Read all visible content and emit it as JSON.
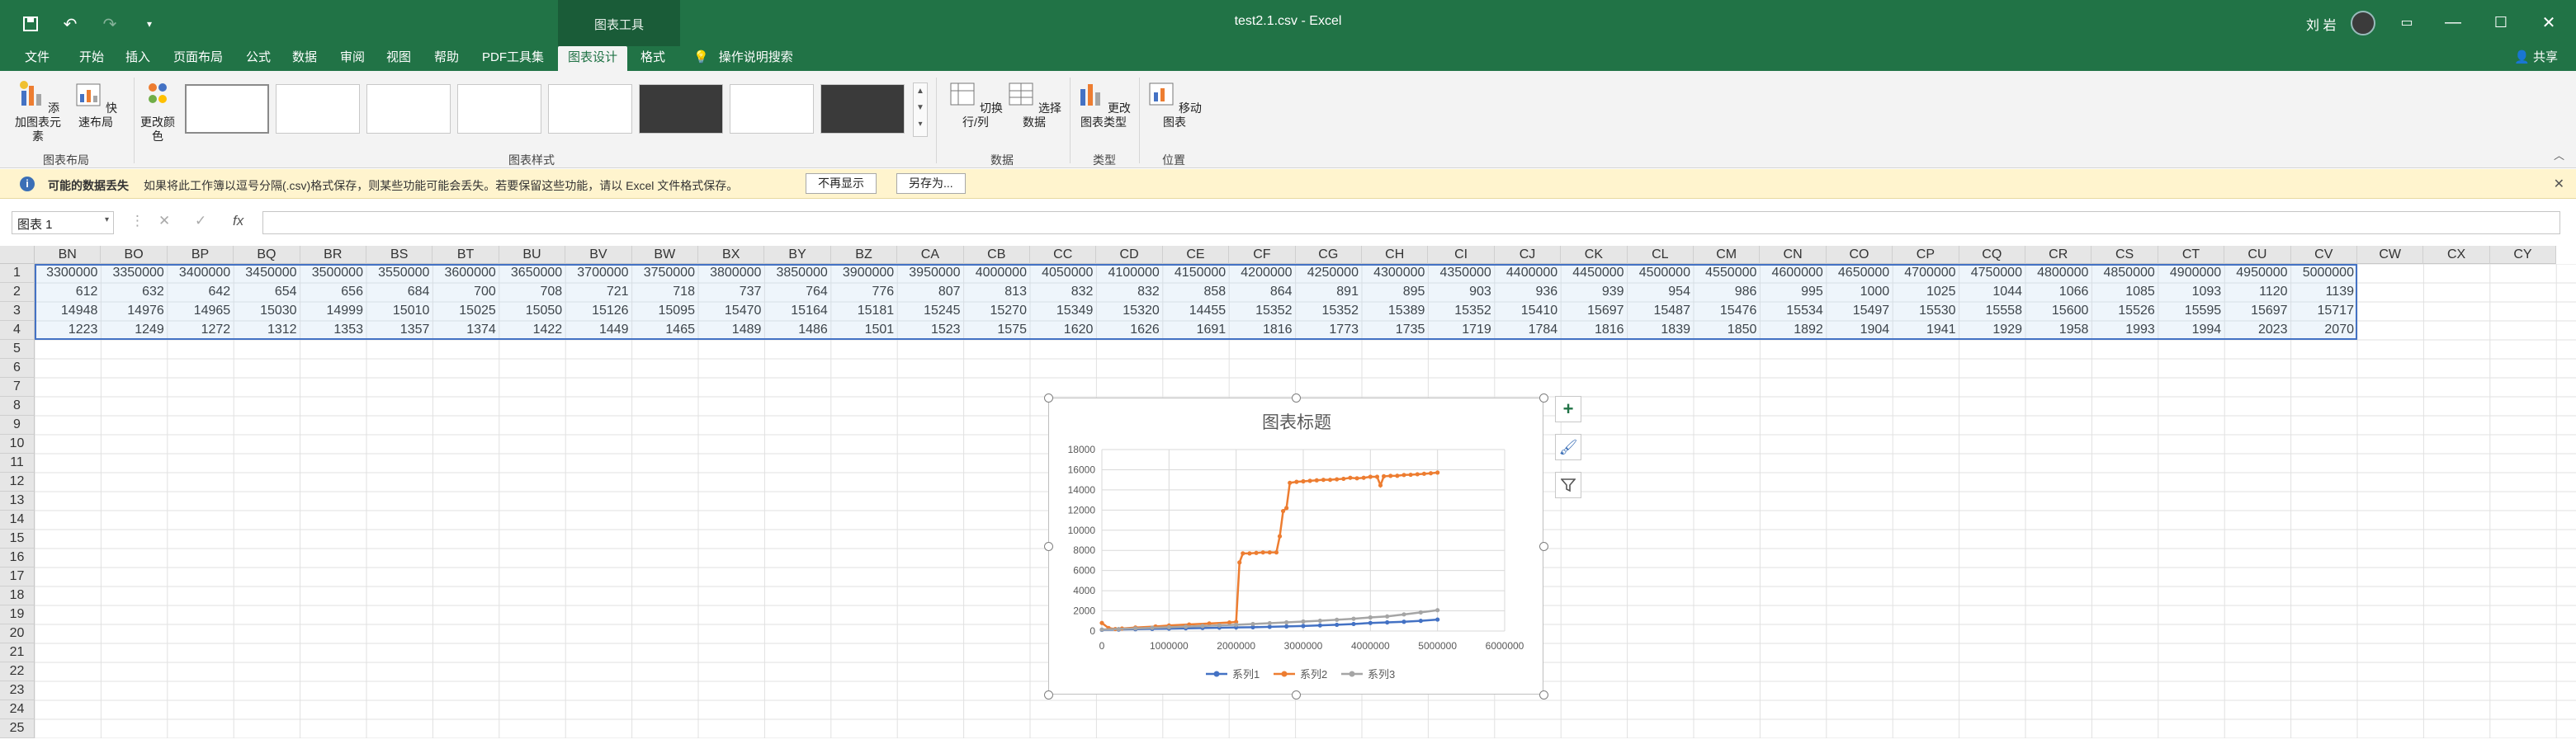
{
  "titlebar": {
    "title": "test2.1.csv - Excel",
    "context_tools": "图表工具",
    "user": "刘 岩"
  },
  "tabs": [
    "文件",
    "开始",
    "插入",
    "页面布局",
    "公式",
    "数据",
    "审阅",
    "视图",
    "帮助",
    "PDF工具集",
    "图表设计",
    "格式"
  ],
  "active_tab": "图表设计",
  "tell_me": "操作说明搜索",
  "share": "共享",
  "ribbon": {
    "add_element": "添加图表元素",
    "quick_layout": "快速布局",
    "change_colors": "更改颜色",
    "switch_row_col": "切换行/列",
    "select_data": "选择数据",
    "change_type": "更改图表类型",
    "move_chart": "移动图表",
    "groups": {
      "layouts": "图表布局",
      "styles": "图表样式",
      "data": "数据",
      "type": "类型",
      "location": "位置"
    }
  },
  "message_bar": {
    "title": "可能的数据丢失",
    "text": "如果将此工作簿以逗号分隔(.csv)格式保存，则某些功能可能会丢失。若要保留这些功能，请以 Excel 文件格式保存。",
    "dont_show": "不再显示",
    "save_as": "另存为..."
  },
  "namebox": "图表 1",
  "columns": [
    "BN",
    "BO",
    "BP",
    "BQ",
    "BR",
    "BS",
    "BT",
    "BU",
    "BV",
    "BW",
    "BX",
    "BY",
    "BZ",
    "CA",
    "CB",
    "CC",
    "CD",
    "CE",
    "CF",
    "CG",
    "CH",
    "CI",
    "CJ",
    "CK",
    "CL",
    "CM",
    "CN",
    "CO",
    "CP",
    "CQ",
    "CR",
    "CS",
    "CT",
    "CU",
    "CV",
    "CW",
    "CX",
    "CY"
  ],
  "rows": [
    [
      "3300000",
      "3350000",
      "3400000",
      "3450000",
      "3500000",
      "3550000",
      "3600000",
      "3650000",
      "3700000",
      "3750000",
      "3800000",
      "3850000",
      "3900000",
      "3950000",
      "4000000",
      "4050000",
      "4100000",
      "4150000",
      "4200000",
      "4250000",
      "4300000",
      "4350000",
      "4400000",
      "4450000",
      "4500000",
      "4550000",
      "4600000",
      "4650000",
      "4700000",
      "4750000",
      "4800000",
      "4850000",
      "4900000",
      "4950000",
      "5000000"
    ],
    [
      "612",
      "632",
      "642",
      "654",
      "656",
      "684",
      "700",
      "708",
      "721",
      "718",
      "737",
      "764",
      "776",
      "807",
      "813",
      "832",
      "832",
      "858",
      "864",
      "891",
      "895",
      "903",
      "936",
      "939",
      "954",
      "986",
      "995",
      "1000",
      "1025",
      "1044",
      "1066",
      "1085",
      "1093",
      "1120",
      "1139"
    ],
    [
      "14948",
      "14976",
      "14965",
      "15030",
      "14999",
      "15010",
      "15025",
      "15050",
      "15126",
      "15095",
      "15470",
      "15164",
      "15181",
      "15245",
      "15270",
      "15349",
      "15320",
      "14455",
      "15352",
      "15352",
      "15389",
      "15352",
      "15410",
      "15697",
      "15487",
      "15476",
      "15534",
      "15497",
      "15530",
      "15558",
      "15600",
      "15526",
      "15595",
      "15697",
      "15717"
    ],
    [
      "1223",
      "1249",
      "1272",
      "1312",
      "1353",
      "1357",
      "1374",
      "1422",
      "1449",
      "1465",
      "1489",
      "1486",
      "1501",
      "1523",
      "1575",
      "1620",
      "1626",
      "1691",
      "1816",
      "1773",
      "1735",
      "1719",
      "1784",
      "1816",
      "1839",
      "1850",
      "1892",
      "1904",
      "1941",
      "1929",
      "1958",
      "1993",
      "1994",
      "2023",
      "2070"
    ]
  ],
  "row_numbers": [
    "1",
    "2",
    "3",
    "4",
    "5",
    "6",
    "7",
    "8",
    "9",
    "10",
    "11",
    "12",
    "13",
    "14",
    "15",
    "16",
    "17",
    "18",
    "19",
    "20",
    "21",
    "22",
    "23",
    "24",
    "25"
  ],
  "chart_data": {
    "type": "line",
    "title": "图表标题",
    "ylim": [
      0,
      18000
    ],
    "xlim": [
      0,
      6000000
    ],
    "yticks": [
      "18000",
      "16000",
      "14000",
      "12000",
      "10000",
      "8000",
      "6000",
      "4000",
      "2000",
      "0"
    ],
    "xticks": [
      "0",
      "1000000",
      "2000000",
      "3000000",
      "4000000",
      "5000000",
      "6000000"
    ],
    "legend_position": "bottom",
    "series": [
      {
        "name": "系列1",
        "color": "#4472c4",
        "x": [
          0,
          250000,
          500000,
          750000,
          1000000,
          1250000,
          1500000,
          1750000,
          2000000,
          2250000,
          2500000,
          2750000,
          3000000,
          3250000,
          3500000,
          3750000,
          4000000,
          4250000,
          4500000,
          4750000,
          5000000
        ],
        "y": [
          120,
          150,
          180,
          210,
          240,
          270,
          300,
          330,
          360,
          380,
          420,
          460,
          500,
          560,
          620,
          700,
          800,
          860,
          920,
          1010,
          1139
        ]
      },
      {
        "name": "系列2",
        "color": "#ed7d31",
        "x": [
          0,
          100000,
          200000,
          300000,
          500000,
          800000,
          1000000,
          1300000,
          1600000,
          1900000,
          2000000,
          2050000,
          2100000,
          2200000,
          2300000,
          2400000,
          2500000,
          2600000,
          2650000,
          2700000,
          2750000,
          2800000,
          2900000,
          3000000,
          3100000,
          3200000,
          3300000,
          3400000,
          3500000,
          3600000,
          3700000,
          3800000,
          3900000,
          4000000,
          4100000,
          4150000,
          4200000,
          4300000,
          4400000,
          4500000,
          4600000,
          4700000,
          4800000,
          4900000,
          5000000
        ],
        "y": [
          800,
          300,
          200,
          250,
          350,
          450,
          550,
          650,
          750,
          850,
          900,
          6800,
          7700,
          7700,
          7750,
          7800,
          7800,
          7800,
          9400,
          11900,
          12200,
          14700,
          14800,
          14850,
          14900,
          14950,
          15000,
          15000,
          15050,
          15100,
          15200,
          15150,
          15200,
          15300,
          15300,
          14455,
          15350,
          15390,
          15400,
          15480,
          15500,
          15550,
          15600,
          15650,
          15717
        ]
      },
      {
        "name": "系列3",
        "color": "#a5a5a5",
        "x": [
          0,
          250000,
          500000,
          750000,
          1000000,
          1250000,
          1500000,
          1750000,
          2000000,
          2250000,
          2500000,
          2750000,
          3000000,
          3250000,
          3500000,
          3750000,
          4000000,
          4250000,
          4500000,
          4750000,
          5000000
        ],
        "y": [
          150,
          200,
          260,
          320,
          380,
          440,
          500,
          560,
          620,
          700,
          780,
          860,
          940,
          1020,
          1120,
          1220,
          1350,
          1450,
          1650,
          1850,
          2070
        ]
      }
    ]
  }
}
